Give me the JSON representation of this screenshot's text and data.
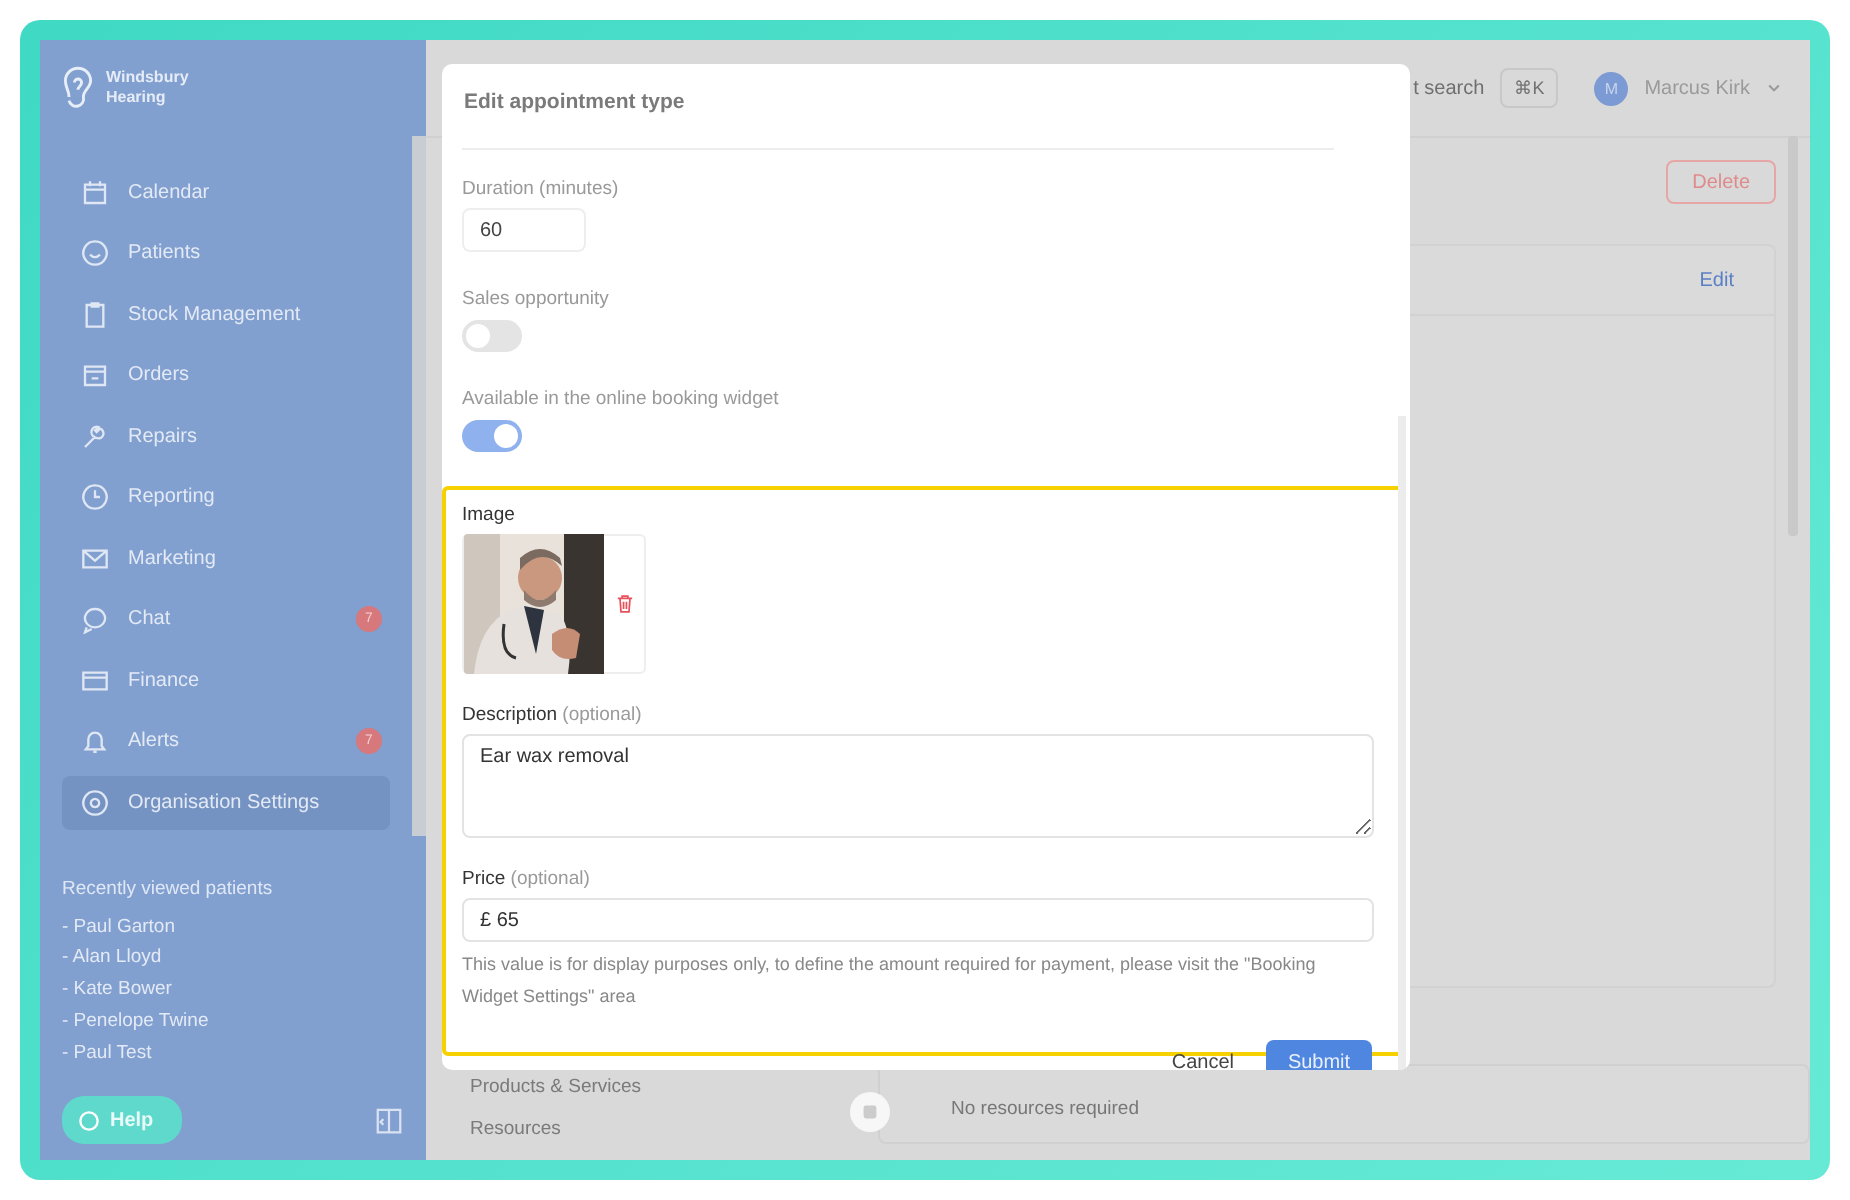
{
  "sidebar": {
    "logo": [
      "Windsbury",
      "Hearing"
    ],
    "nav": [
      {
        "label": "Calendar",
        "selected": false
      },
      {
        "label": "Patients",
        "selected": false
      },
      {
        "label": "Stock Management",
        "selected": false
      },
      {
        "label": "Orders",
        "selected": false
      },
      {
        "label": "Repairs",
        "selected": false
      },
      {
        "label": "Reporting",
        "selected": false
      },
      {
        "label": "Marketing",
        "selected": false
      },
      {
        "label": "Chat",
        "badge": "7",
        "selected": false
      },
      {
        "label": "Finance",
        "selected": false
      },
      {
        "label": "Alerts",
        "badge": "7",
        "selected": false
      },
      {
        "label": "Organisation Settings",
        "selected": true
      }
    ],
    "recent_title": "Recently viewed patients",
    "recent": [
      "- Paul Garton",
      "- Alan Lloyd",
      "- Kate Bower",
      "- Penelope Twine",
      "- Paul Test"
    ],
    "help": "Help"
  },
  "topbar": {
    "search": "t search",
    "shortcut": "⌘K",
    "avatar": "M",
    "user": "Marcus Kirk"
  },
  "page": {
    "delete": "Delete",
    "edit": "Edit",
    "menu": [
      "Products & Services",
      "Resources"
    ],
    "note": "No resources required"
  },
  "modal": {
    "title": "Edit appointment type",
    "duration": {
      "label": "Duration (minutes)",
      "value": "60"
    },
    "toggles": [
      {
        "label": "Sales opportunity",
        "on": false
      },
      {
        "label": "Available in the online booking widget",
        "on": true
      }
    ],
    "image_label": "Image",
    "description": {
      "label": "Description",
      "hint": "(optional)",
      "value": "Ear wax removal"
    },
    "price": {
      "label": "Price",
      "hint": "(optional)",
      "value": "£ 65",
      "help": "This value is for display purposes only, to define the amount required for payment, please visit the \"Booking Widget Settings\" area"
    },
    "cancel": "Cancel",
    "submit": "Submit"
  }
}
